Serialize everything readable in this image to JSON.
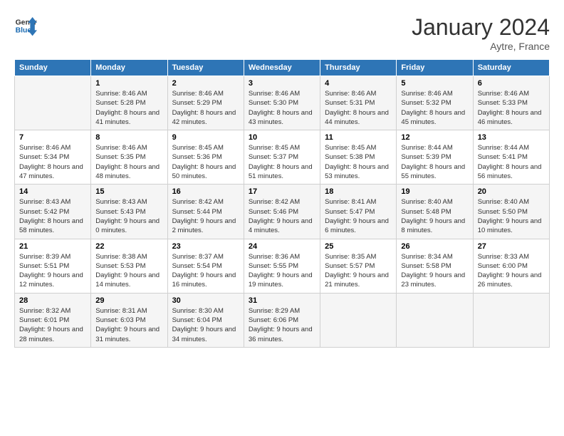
{
  "logo": {
    "line1": "General",
    "line2": "Blue"
  },
  "title": "January 2024",
  "subtitle": "Aytre, France",
  "days_header": [
    "Sunday",
    "Monday",
    "Tuesday",
    "Wednesday",
    "Thursday",
    "Friday",
    "Saturday"
  ],
  "weeks": [
    [
      {
        "day": "",
        "sunrise": "",
        "sunset": "",
        "daylight": ""
      },
      {
        "day": "1",
        "sunrise": "Sunrise: 8:46 AM",
        "sunset": "Sunset: 5:28 PM",
        "daylight": "Daylight: 8 hours and 41 minutes."
      },
      {
        "day": "2",
        "sunrise": "Sunrise: 8:46 AM",
        "sunset": "Sunset: 5:29 PM",
        "daylight": "Daylight: 8 hours and 42 minutes."
      },
      {
        "day": "3",
        "sunrise": "Sunrise: 8:46 AM",
        "sunset": "Sunset: 5:30 PM",
        "daylight": "Daylight: 8 hours and 43 minutes."
      },
      {
        "day": "4",
        "sunrise": "Sunrise: 8:46 AM",
        "sunset": "Sunset: 5:31 PM",
        "daylight": "Daylight: 8 hours and 44 minutes."
      },
      {
        "day": "5",
        "sunrise": "Sunrise: 8:46 AM",
        "sunset": "Sunset: 5:32 PM",
        "daylight": "Daylight: 8 hours and 45 minutes."
      },
      {
        "day": "6",
        "sunrise": "Sunrise: 8:46 AM",
        "sunset": "Sunset: 5:33 PM",
        "daylight": "Daylight: 8 hours and 46 minutes."
      }
    ],
    [
      {
        "day": "7",
        "sunrise": "Sunrise: 8:46 AM",
        "sunset": "Sunset: 5:34 PM",
        "daylight": "Daylight: 8 hours and 47 minutes."
      },
      {
        "day": "8",
        "sunrise": "Sunrise: 8:46 AM",
        "sunset": "Sunset: 5:35 PM",
        "daylight": "Daylight: 8 hours and 48 minutes."
      },
      {
        "day": "9",
        "sunrise": "Sunrise: 8:45 AM",
        "sunset": "Sunset: 5:36 PM",
        "daylight": "Daylight: 8 hours and 50 minutes."
      },
      {
        "day": "10",
        "sunrise": "Sunrise: 8:45 AM",
        "sunset": "Sunset: 5:37 PM",
        "daylight": "Daylight: 8 hours and 51 minutes."
      },
      {
        "day": "11",
        "sunrise": "Sunrise: 8:45 AM",
        "sunset": "Sunset: 5:38 PM",
        "daylight": "Daylight: 8 hours and 53 minutes."
      },
      {
        "day": "12",
        "sunrise": "Sunrise: 8:44 AM",
        "sunset": "Sunset: 5:39 PM",
        "daylight": "Daylight: 8 hours and 55 minutes."
      },
      {
        "day": "13",
        "sunrise": "Sunrise: 8:44 AM",
        "sunset": "Sunset: 5:41 PM",
        "daylight": "Daylight: 8 hours and 56 minutes."
      }
    ],
    [
      {
        "day": "14",
        "sunrise": "Sunrise: 8:43 AM",
        "sunset": "Sunset: 5:42 PM",
        "daylight": "Daylight: 8 hours and 58 minutes."
      },
      {
        "day": "15",
        "sunrise": "Sunrise: 8:43 AM",
        "sunset": "Sunset: 5:43 PM",
        "daylight": "Daylight: 9 hours and 0 minutes."
      },
      {
        "day": "16",
        "sunrise": "Sunrise: 8:42 AM",
        "sunset": "Sunset: 5:44 PM",
        "daylight": "Daylight: 9 hours and 2 minutes."
      },
      {
        "day": "17",
        "sunrise": "Sunrise: 8:42 AM",
        "sunset": "Sunset: 5:46 PM",
        "daylight": "Daylight: 9 hours and 4 minutes."
      },
      {
        "day": "18",
        "sunrise": "Sunrise: 8:41 AM",
        "sunset": "Sunset: 5:47 PM",
        "daylight": "Daylight: 9 hours and 6 minutes."
      },
      {
        "day": "19",
        "sunrise": "Sunrise: 8:40 AM",
        "sunset": "Sunset: 5:48 PM",
        "daylight": "Daylight: 9 hours and 8 minutes."
      },
      {
        "day": "20",
        "sunrise": "Sunrise: 8:40 AM",
        "sunset": "Sunset: 5:50 PM",
        "daylight": "Daylight: 9 hours and 10 minutes."
      }
    ],
    [
      {
        "day": "21",
        "sunrise": "Sunrise: 8:39 AM",
        "sunset": "Sunset: 5:51 PM",
        "daylight": "Daylight: 9 hours and 12 minutes."
      },
      {
        "day": "22",
        "sunrise": "Sunrise: 8:38 AM",
        "sunset": "Sunset: 5:53 PM",
        "daylight": "Daylight: 9 hours and 14 minutes."
      },
      {
        "day": "23",
        "sunrise": "Sunrise: 8:37 AM",
        "sunset": "Sunset: 5:54 PM",
        "daylight": "Daylight: 9 hours and 16 minutes."
      },
      {
        "day": "24",
        "sunrise": "Sunrise: 8:36 AM",
        "sunset": "Sunset: 5:55 PM",
        "daylight": "Daylight: 9 hours and 19 minutes."
      },
      {
        "day": "25",
        "sunrise": "Sunrise: 8:35 AM",
        "sunset": "Sunset: 5:57 PM",
        "daylight": "Daylight: 9 hours and 21 minutes."
      },
      {
        "day": "26",
        "sunrise": "Sunrise: 8:34 AM",
        "sunset": "Sunset: 5:58 PM",
        "daylight": "Daylight: 9 hours and 23 minutes."
      },
      {
        "day": "27",
        "sunrise": "Sunrise: 8:33 AM",
        "sunset": "Sunset: 6:00 PM",
        "daylight": "Daylight: 9 hours and 26 minutes."
      }
    ],
    [
      {
        "day": "28",
        "sunrise": "Sunrise: 8:32 AM",
        "sunset": "Sunset: 6:01 PM",
        "daylight": "Daylight: 9 hours and 28 minutes."
      },
      {
        "day": "29",
        "sunrise": "Sunrise: 8:31 AM",
        "sunset": "Sunset: 6:03 PM",
        "daylight": "Daylight: 9 hours and 31 minutes."
      },
      {
        "day": "30",
        "sunrise": "Sunrise: 8:30 AM",
        "sunset": "Sunset: 6:04 PM",
        "daylight": "Daylight: 9 hours and 34 minutes."
      },
      {
        "day": "31",
        "sunrise": "Sunrise: 8:29 AM",
        "sunset": "Sunset: 6:06 PM",
        "daylight": "Daylight: 9 hours and 36 minutes."
      },
      {
        "day": "",
        "sunrise": "",
        "sunset": "",
        "daylight": ""
      },
      {
        "day": "",
        "sunrise": "",
        "sunset": "",
        "daylight": ""
      },
      {
        "day": "",
        "sunrise": "",
        "sunset": "",
        "daylight": ""
      }
    ]
  ]
}
